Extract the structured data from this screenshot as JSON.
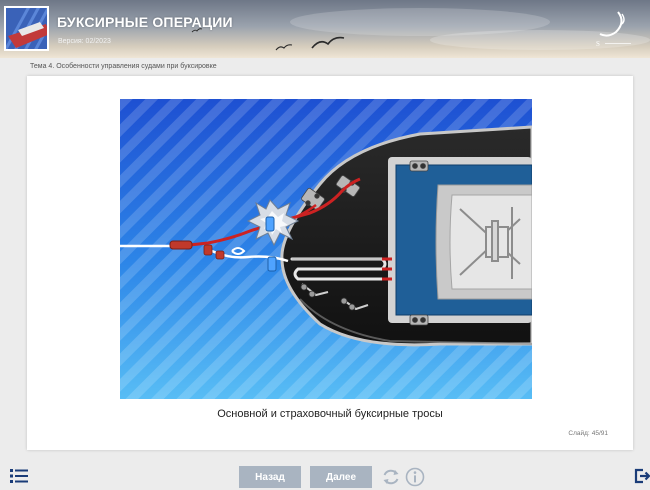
{
  "header": {
    "title": "БУКСИРНЫЕ ОПЕРАЦИИ",
    "version": "Версия: 02/2023",
    "logo_icon": "ship-bow-thumbnail",
    "brand_icon": "brand-wave-logo"
  },
  "topic": "Тема 4. Особенности управления судами при буксировке",
  "slide": {
    "caption": "Основной и страховочный буксирные тросы",
    "counter_label": "Слайд:",
    "counter_value": "45/91"
  },
  "nav": {
    "back_label": "Назад",
    "next_label": "Далее",
    "menu_icon": "list-menu-icon",
    "reload_icon": "reload-icon",
    "info_icon": "info-icon",
    "exit_icon": "exit-icon"
  },
  "colors": {
    "water_dark": "#1e56d6",
    "water_light": "#4fb2f2",
    "hull": "#1b1b1b",
    "deck_blue": "#1f5f9a",
    "rope_main": "#cc2222",
    "rope_safety": "#ffffff",
    "button": "#a9b4c1"
  }
}
